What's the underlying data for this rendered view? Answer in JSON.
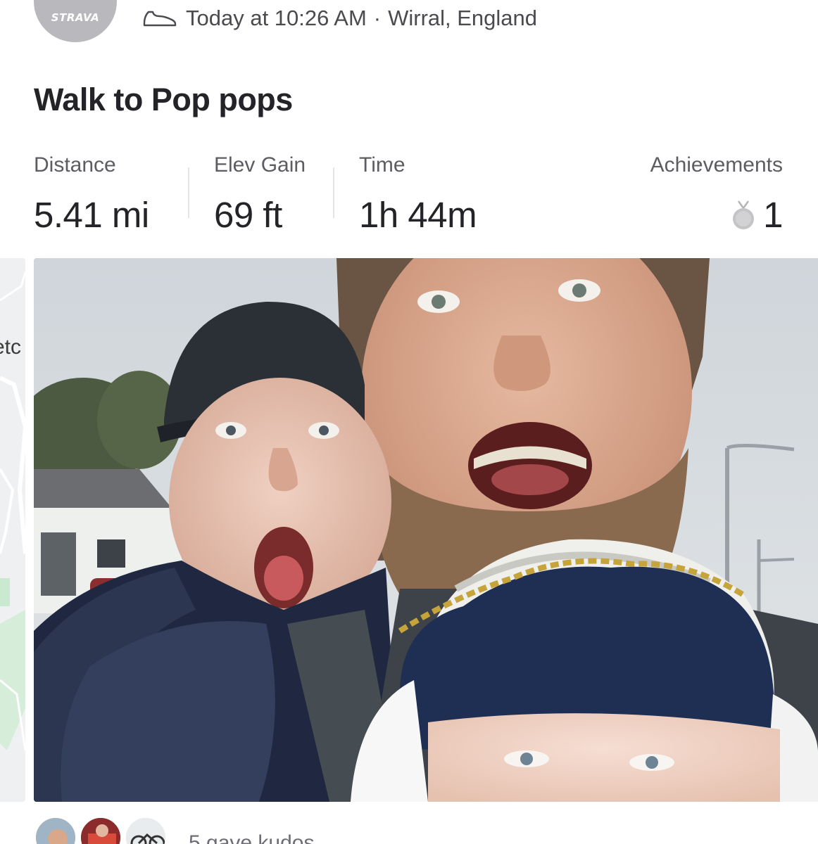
{
  "header": {
    "club_logo_text": "STRAVA",
    "activity_icon": "shoe-icon",
    "timestamp": "Today at 10:26 AM",
    "separator": "·",
    "location": "Wirral, England"
  },
  "activity": {
    "title": "Walk to Pop pops"
  },
  "stats": {
    "distance": {
      "label": "Distance",
      "value": "5.41 mi"
    },
    "elevation": {
      "label": "Elev Gain",
      "value": "69 ft"
    },
    "time": {
      "label": "Time",
      "value": "1h 44m"
    },
    "achievements": {
      "label": "Achievements",
      "icon": "medal-icon",
      "value": "1"
    }
  },
  "media": {
    "map_partial_label": "etc"
  },
  "kudos": {
    "text": "5 gave kudos"
  },
  "colors": {
    "text_primary": "#242428",
    "text_secondary": "#5c5c62",
    "divider": "#e4e4e6",
    "avatar_bg": "#b9b9bd"
  }
}
